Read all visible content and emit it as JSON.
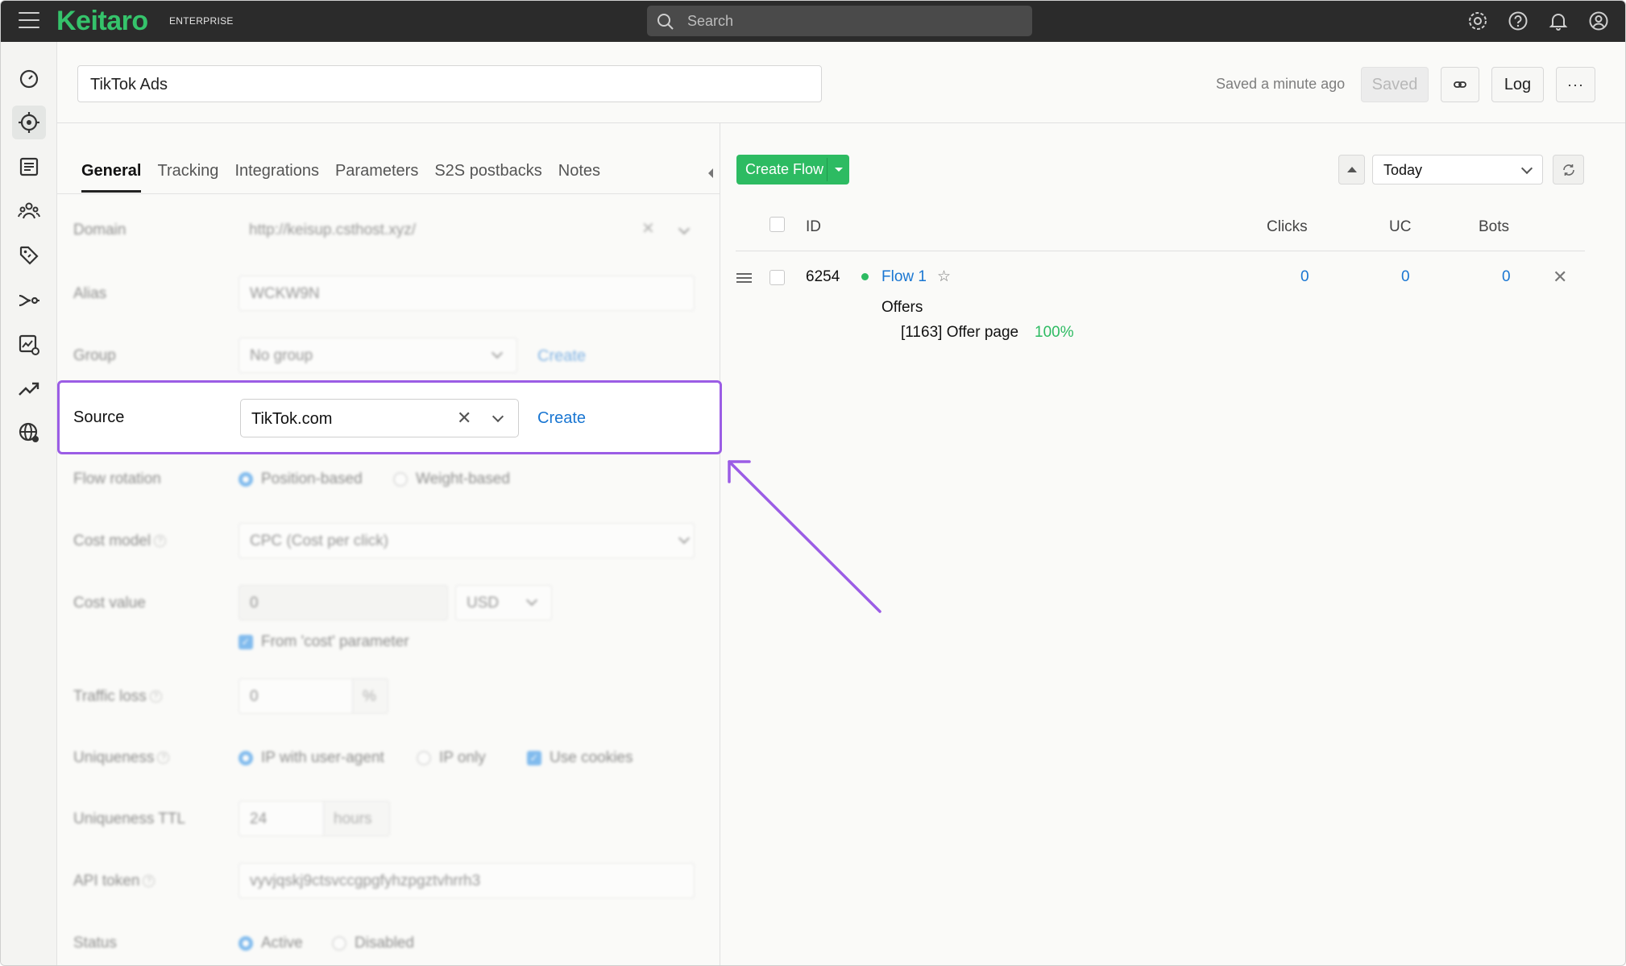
{
  "app": {
    "logo": "Keitaro",
    "edition": "ENTERPRISE"
  },
  "search": {
    "placeholder": "Search"
  },
  "campaign": {
    "name": "TikTok Ads",
    "saved_status": "Saved a minute ago",
    "saved_button": "Saved",
    "log_button": "Log",
    "more_button": "···"
  },
  "tabs": [
    "General",
    "Tracking",
    "Integrations",
    "Parameters",
    "S2S postbacks",
    "Notes"
  ],
  "form": {
    "domain": {
      "label": "Domain",
      "value": "http://keisup.csthost.xyz/"
    },
    "alias": {
      "label": "Alias",
      "value": "WCKW9N"
    },
    "group": {
      "label": "Group",
      "value": "No group",
      "create": "Create"
    },
    "source": {
      "label": "Source",
      "value": "TikTok.com",
      "clear": "✕",
      "create": "Create"
    },
    "flow_rotation": {
      "label": "Flow rotation",
      "opt1": "Position-based",
      "opt2": "Weight-based"
    },
    "cost_model": {
      "label": "Cost model",
      "value": "CPC (Cost per click)"
    },
    "cost_value": {
      "label": "Cost value",
      "value": "0",
      "currency": "USD",
      "from_param": "From 'cost' parameter"
    },
    "traffic_loss": {
      "label": "Traffic loss",
      "value": "0",
      "unit": "%"
    },
    "uniqueness": {
      "label": "Uniqueness",
      "opt1": "IP with user-agent",
      "opt2": "IP only",
      "cookies": "Use cookies"
    },
    "uniqueness_ttl": {
      "label": "Uniqueness TTL",
      "value": "24",
      "unit": "hours"
    },
    "api_token": {
      "label": "API token",
      "value": "vyvjqskj9ctsvccgpgfyhzpgztvhrrh3"
    },
    "status": {
      "label": "Status",
      "opt1": "Active",
      "opt2": "Disabled"
    },
    "help": "?"
  },
  "flows": {
    "create_button": "Create Flow",
    "date_range": "Today",
    "columns": {
      "id": "ID",
      "clicks": "Clicks",
      "uc": "UC",
      "bots": "Bots"
    },
    "rows": [
      {
        "id": "6254",
        "name": "Flow 1",
        "star": "☆",
        "clicks": "0",
        "uc": "0",
        "bots": "0",
        "remove": "✕",
        "offers_label": "Offers",
        "offer": "[1163] Offer page",
        "offer_share": "100%"
      }
    ]
  },
  "colors": {
    "brand": "#35c36b",
    "accent": "#1976d2",
    "highlight": "#9b5de5",
    "success": "#2dbb62"
  },
  "icons": [
    "menu-icon",
    "search-icon",
    "gear-icon",
    "help-icon",
    "bell-icon",
    "user-icon",
    "dashboard-icon",
    "campaigns-icon",
    "landing-pages-icon",
    "affiliate-networks-icon",
    "offers-icon",
    "traffic-sources-icon",
    "reports-icon",
    "trends-icon",
    "domains-icon",
    "link-icon",
    "refresh-icon"
  ]
}
